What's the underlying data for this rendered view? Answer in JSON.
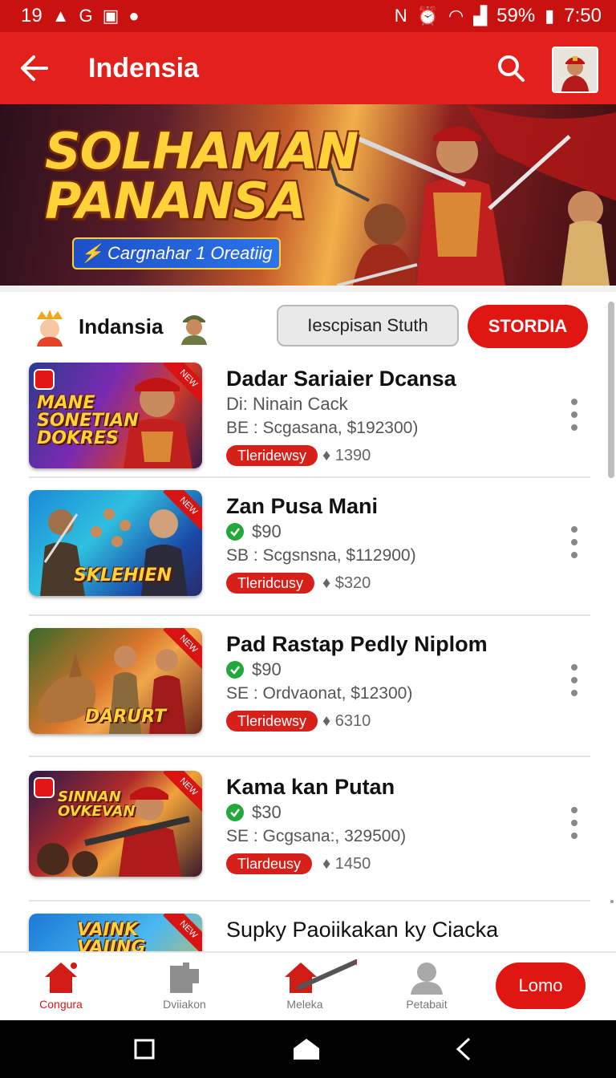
{
  "status_bar": {
    "time_left": "19",
    "battery": "59%",
    "time_right": "7:50"
  },
  "header": {
    "title": "Indensia"
  },
  "banner": {
    "title_line1": "SOLHAMAN",
    "title_line2": "PANANSA",
    "pill_text": "⚡ Cargnahar 1 Oreatiig"
  },
  "filter": {
    "label": "Indansia",
    "input_value": "Iescpisan Stuth",
    "button_label": "STORDIA"
  },
  "items": [
    {
      "title": "Dadar Sariaier Dcansa",
      "line1": "Di: Ninain Cack",
      "line2": "BE : Scgasana, $192300)",
      "badge": "Tleridewsy",
      "count": "1390",
      "thumb_text": "MANE SONETIAN DOKRES",
      "verified": false
    },
    {
      "title": "Zan Pusa Mani",
      "line1": "$90",
      "line2": "SB : Scgsnsna, $112900)",
      "badge": "Tleridcusy",
      "count": "$320",
      "thumb_text": "SKLEHIEN",
      "verified": true
    },
    {
      "title": "Pad Rastap Pedly Niplom",
      "line1": "$90",
      "line2": "SE : Ordvaonat, $12300)",
      "badge": "Tleridewsy",
      "count": "6310",
      "thumb_text": "DARURT",
      "verified": true
    },
    {
      "title": "Kama kan Putan",
      "line1": "$30",
      "line2": "SE : Gcgsana:, 329500)",
      "badge": "Tlardeusy",
      "count": "1450",
      "thumb_text": "SINNAN OVKEVAN",
      "verified": true
    },
    {
      "title": "Supky Paoiikakan ky Ciacka",
      "thumb_text": "VAINK VAIING"
    }
  ],
  "bottom_nav": {
    "items": [
      {
        "label": "Congura",
        "icon": "home-icon",
        "active": true
      },
      {
        "label": "Dviiakon",
        "icon": "puzzle-icon",
        "active": false
      },
      {
        "label": "Meleka",
        "icon": "house-tool-icon",
        "active": false
      },
      {
        "label": "Petabait",
        "icon": "person-icon",
        "active": false
      }
    ],
    "button_label": "Lomo"
  },
  "colors": {
    "brand_red": "#e2211c",
    "status_red": "#c9120f",
    "check_green": "#23a93b"
  }
}
